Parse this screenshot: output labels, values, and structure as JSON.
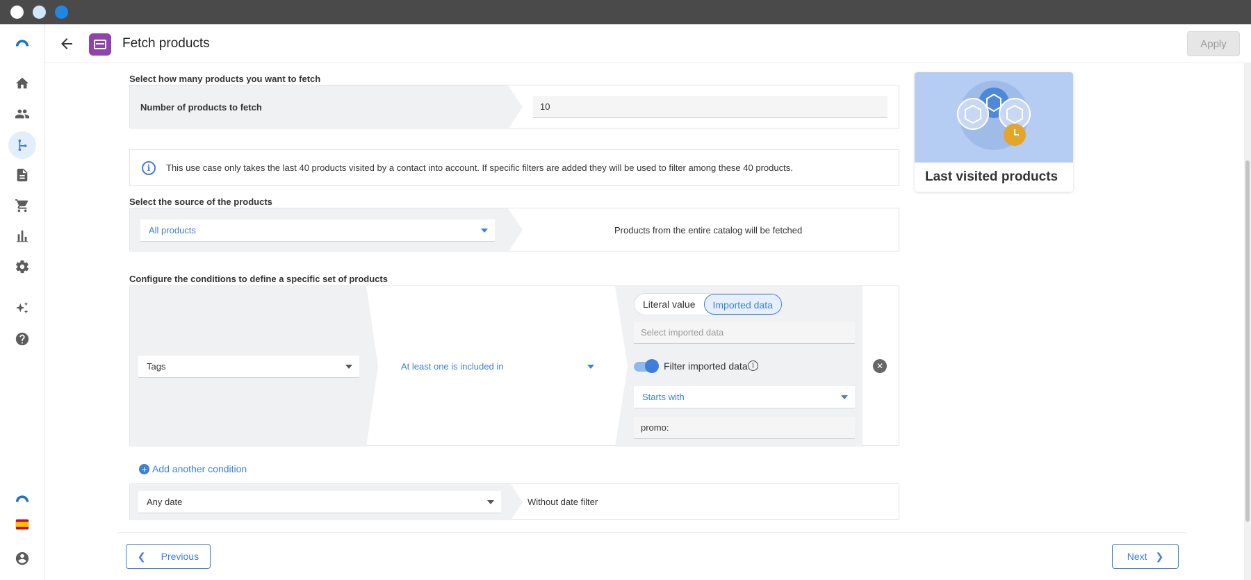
{
  "header": {
    "title": "Fetch products",
    "apply_label": "Apply"
  },
  "sidebar": {
    "items": [
      "home-icon",
      "contacts-icon",
      "automation-icon",
      "document-icon",
      "cart-icon",
      "chart-icon",
      "settings-icon",
      "sparkles-icon",
      "help-icon",
      "brand-logo-icon",
      "spain-flag-icon",
      "account-icon"
    ]
  },
  "quantity": {
    "section_label": "Select how many products you want to fetch",
    "field_label": "Number of products to fetch",
    "value": "10"
  },
  "info": {
    "text": "This use case only takes the last 40 products visited by a contact into account. If specific filters are added they will be used to filter among these 40 products."
  },
  "source": {
    "section_label": "Select the source of the products",
    "selected": "All products",
    "description": "Products from the entire catalog will be fetched"
  },
  "conditions": {
    "section_label": "Configure the conditions to define a specific set of products",
    "field_selected": "Tags",
    "operator_selected": "At least one is included in",
    "value_mode_options": [
      "Literal value",
      "Imported data"
    ],
    "value_mode_selected": "Imported data",
    "imported_placeholder": "Select imported data",
    "filter_toggle_label": "Filter imported data",
    "filter_toggle_on": true,
    "filter_operator": "Starts with",
    "filter_value": "promo:",
    "add_condition_label": "Add another condition"
  },
  "date_filter": {
    "selected": "Any date",
    "description": "Without date filter"
  },
  "card": {
    "title": "Last visited products"
  },
  "footer": {
    "previous_label": "Previous",
    "next_label": "Next"
  },
  "colors": {
    "accent": "#3d7fd9",
    "fetch_icon": "#8e44ad",
    "card_bg": "#b6cdf3"
  }
}
